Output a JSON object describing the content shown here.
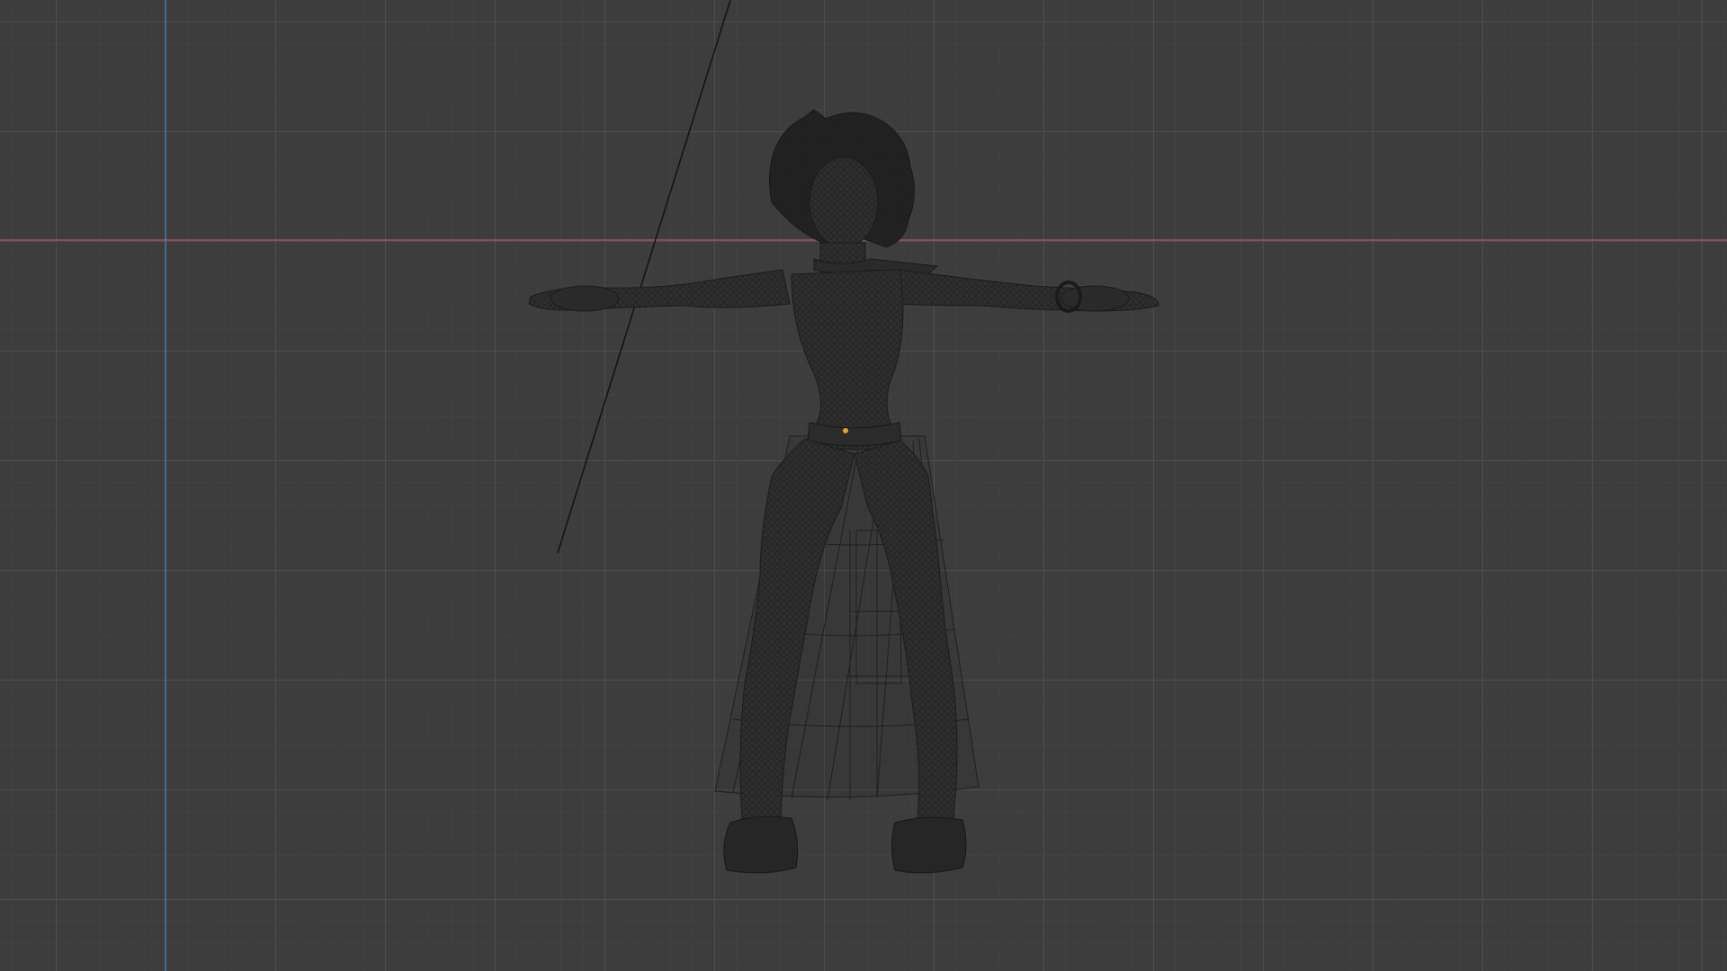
{
  "viewport": {
    "background": "#3d3d3d",
    "grid_minor": "#434343",
    "grid_major": "#4e4e4e",
    "x_axis_color": "#c0555b",
    "y_axis_color": "#5180c0",
    "origin_color": "#f0a020"
  },
  "objects": [
    {
      "name": "character-mesh",
      "display": "wireframe",
      "pose": "T-pose"
    },
    {
      "name": "skirt-cage",
      "display": "wireframe"
    },
    {
      "name": "camera-line",
      "display": "line"
    }
  ]
}
